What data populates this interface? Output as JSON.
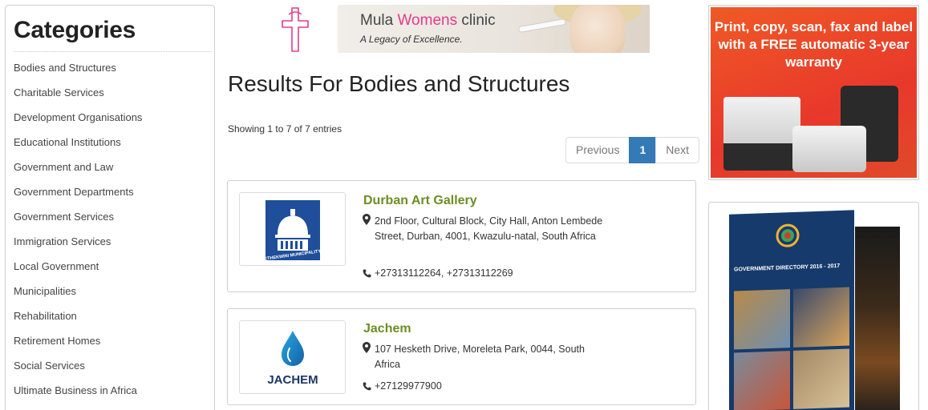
{
  "sidebar": {
    "title": "Categories",
    "items": [
      "Bodies and Structures",
      "Charitable Services",
      "Development Organisations",
      "Educational Institutions",
      "Government and Law",
      "Government Departments",
      "Government Services",
      "Immigration Services",
      "Local Government",
      "Municipalities",
      "Rehabilitation",
      "Retirement Homes",
      "Social Services",
      "Ultimate Business in Africa"
    ]
  },
  "top_banner": {
    "clinic_name_part1": "Mula",
    "clinic_name_part2": "Womens",
    "clinic_name_part3": "clinic",
    "tagline": "A Legacy of Excellence.",
    "accent_color": "#e23c8d"
  },
  "main": {
    "title": "Results For Bodies and Structures",
    "showing": "Showing 1 to 7 of 7 entries",
    "pagination": {
      "previous": "Previous",
      "current": "1",
      "next": "Next",
      "active_color": "#337ab7"
    },
    "listings": [
      {
        "name": "Durban Art Gallery",
        "logo_text": "ETHEKWINI MUNICIPALITY",
        "address": "2nd Floor, Cultural Block, City Hall, Anton Lembede Street, Durban, 4001, Kwazulu-natal, South Africa",
        "phone": "+27313112264, +27313112269"
      },
      {
        "name": "Jachem",
        "logo_text": "JACHEM",
        "address": "107 Hesketh Drive, Moreleta Park, 0044, South Africa",
        "phone": "+27129977900"
      }
    ],
    "name_color": "#6b8e23"
  },
  "ads": {
    "printer": {
      "headline": "Print, copy, scan, fax and label with a FREE automatic 3-year warranty"
    },
    "directory": {
      "cover_title": "GOVERNMENT DIRECTORY 2016 - 2017"
    }
  },
  "icons": {
    "address": "map-marker-icon",
    "phone": "phone-icon"
  }
}
